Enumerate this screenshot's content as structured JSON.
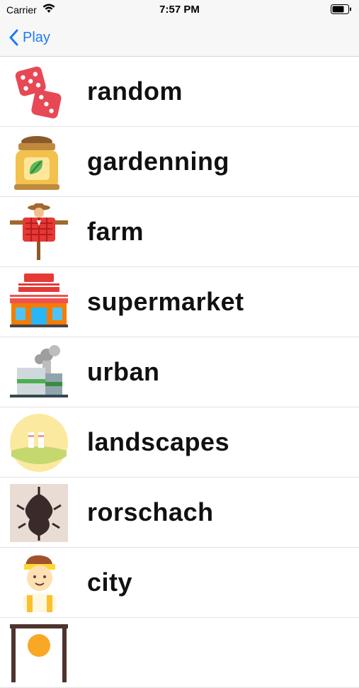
{
  "status_bar": {
    "carrier": "Carrier",
    "time": "7:57 PM"
  },
  "nav": {
    "back_label": "Play"
  },
  "categories": [
    {
      "label": "random",
      "icon": "dice-icon"
    },
    {
      "label": "gardenning",
      "icon": "seed-bag-icon"
    },
    {
      "label": "farm",
      "icon": "scarecrow-icon"
    },
    {
      "label": "supermarket",
      "icon": "store-icon"
    },
    {
      "label": "urban",
      "icon": "factory-icon"
    },
    {
      "label": "landscapes",
      "icon": "landscape-icon"
    },
    {
      "label": "rorschach",
      "icon": "inkblot-icon"
    },
    {
      "label": "city",
      "icon": "worker-icon"
    },
    {
      "label": "",
      "icon": "gong-icon"
    }
  ],
  "colors": {
    "accent": "#1a7cf5",
    "separator": "#e3e3e3"
  }
}
